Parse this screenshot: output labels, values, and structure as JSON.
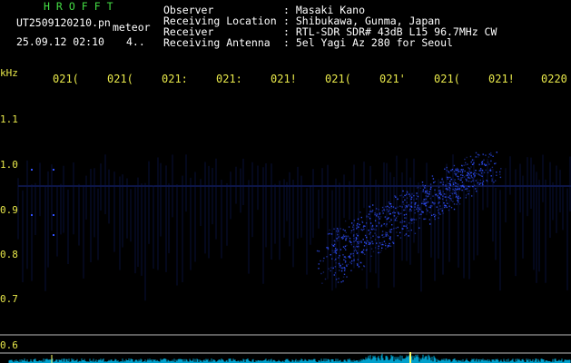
{
  "header": {
    "brand": "HROFFT",
    "filename": "UT2509120210.pn",
    "meteor_label": "meteor",
    "date_time": "25.09.12 02:10",
    "count": "4.."
  },
  "station": [
    {
      "label": "Observer",
      "value": ": Masaki Kano"
    },
    {
      "label": "Receiving Location",
      "value": ": Shibukawa, Gunma, Japan"
    },
    {
      "label": "Receiver",
      "value": ": RTL-SDR SDR# 43dB L15 96.7MHz CW"
    },
    {
      "label": "Receiving Antenna",
      "value": ": 5el Yagi Az 280 for Seoul"
    }
  ],
  "axis": {
    "unit": "kHz",
    "time_ticks": [
      "021(",
      "021(",
      "021:",
      "021:",
      "021!",
      "021(",
      "021'",
      "021(",
      "021!",
      "0220"
    ],
    "freq_ticks": [
      "1.1",
      "1.0",
      "0.9",
      "0.8",
      "0.7",
      "0.6"
    ]
  },
  "colors": {
    "background": "#000000",
    "text_green": "#44dd44",
    "text_white": "#ffffff",
    "text_yellow": "#e8e84a",
    "signal": "#3050ff",
    "baseline": "#00c8ff"
  }
}
